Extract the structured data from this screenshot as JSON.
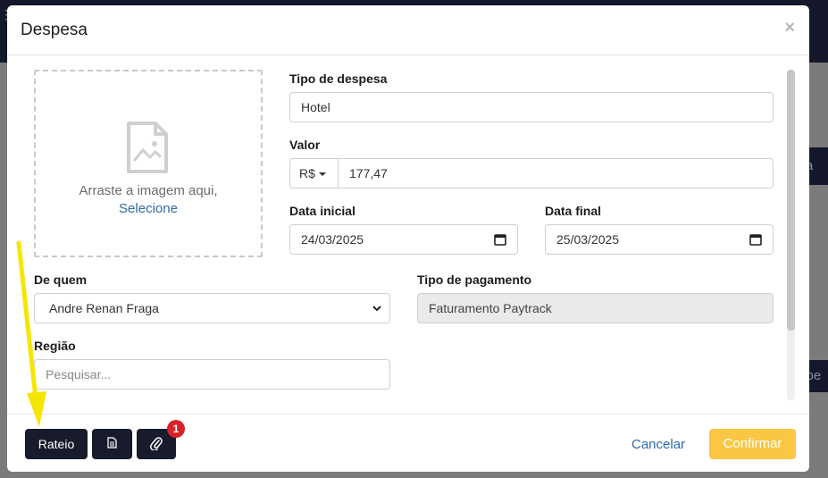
{
  "modal": {
    "title": "Despesa",
    "close_label": "×"
  },
  "dropzone": {
    "text": "Arraste a imagem aqui,",
    "link": "Selecione"
  },
  "fields": {
    "tipo_despesa": {
      "label": "Tipo de despesa",
      "value": "Hotel"
    },
    "valor": {
      "label": "Valor",
      "currency": "R$",
      "value": "177,47"
    },
    "data_inicial": {
      "label": "Data inicial",
      "value": "24/03/2025"
    },
    "data_final": {
      "label": "Data final",
      "value": "25/03/2025"
    },
    "de_quem": {
      "label": "De quem",
      "value": "Andre Renan Fraga"
    },
    "tipo_pagamento": {
      "label": "Tipo de pagamento",
      "value": "Faturamento Paytrack"
    },
    "regiao": {
      "label": "Região",
      "placeholder": "Pesquisar..."
    }
  },
  "footer": {
    "rateio_label": "Rateio",
    "attachment_badge": "1",
    "cancel_label": "Cancelar",
    "confirm_label": "Confirmar"
  },
  "colors": {
    "dark": "#181b2b",
    "confirm": "#f9c744",
    "link": "#2f6aa8",
    "badge": "#d92127",
    "arrow": "#f5e600"
  },
  "icons": {
    "image_placeholder": "image-file-icon",
    "document": "document-icon",
    "attachment": "paperclip-icon",
    "calendar": "calendar-icon",
    "chevron": "chevron-down-icon"
  }
}
